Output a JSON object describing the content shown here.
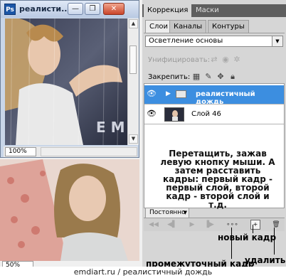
{
  "document_window": {
    "ps_icon": "Ps",
    "title": "реалисти...",
    "minimize_glyph": "—",
    "restore_glyph": "❐",
    "close_glyph": "✕",
    "zoom": "100%"
  },
  "second_window": {
    "zoom": "50%"
  },
  "panel": {
    "top_tabs": [
      "Коррекция",
      "Маски"
    ],
    "layer_tabs": [
      "Слои",
      "Каналы",
      "Контуры"
    ],
    "blend_mode": "Осветление основы",
    "unify_label": "Унифицировать:",
    "lock_label": "Закрепить:",
    "layers": [
      {
        "name": "реалистичный дождь",
        "selected": true,
        "type": "group"
      },
      {
        "name": "Слой 46",
        "selected": false,
        "type": "layer"
      }
    ]
  },
  "instructions": "Перетащить, зажав левую кнопку мыши. А затем расставить кадры: первый кадр - первый слой, второй кадр - второй слой и т.д.",
  "animation": {
    "loop_label": "Постоянно",
    "annotations": {
      "new_frame": "новый кадр",
      "tween": "промежуточный кадр",
      "delete": "удалить"
    }
  },
  "footer": "emdiart.ru  /  реалистичный дождь",
  "colors": {
    "selection": "#3c8ee0",
    "panel_bg": "#d6d6d6",
    "dark_tabbar": "#5e5e5e"
  },
  "icons": [
    "photoshop-icon",
    "eye-icon",
    "folder-icon",
    "lock-icon",
    "brush-icon",
    "move-icon",
    "trash-icon",
    "new-frame-icon",
    "tween-icon"
  ]
}
